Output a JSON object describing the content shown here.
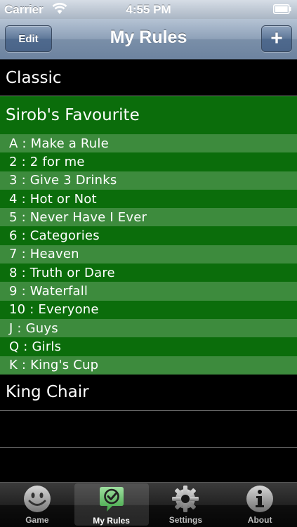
{
  "status_bar": {
    "carrier": "Carrier",
    "time": "4:55 PM"
  },
  "nav": {
    "title": "My Rules",
    "edit_label": "Edit",
    "add_label": "+"
  },
  "rule_sets": [
    {
      "name": "Classic"
    },
    {
      "name": "Sirob's Favourite",
      "selected": true,
      "rules": [
        "A : Make a Rule",
        "2 : 2 for me",
        "3 : Give 3 Drinks",
        "4 : Hot or Not",
        "5 : Never Have I Ever",
        "6 : Categories",
        "7 : Heaven",
        "8 : Truth or Dare",
        "9 : Waterfall",
        "10 : Everyone",
        "J : Guys",
        "Q : Girls",
        "K : King's Cup"
      ]
    },
    {
      "name": "King Chair"
    }
  ],
  "tabs": [
    {
      "label": "Game",
      "icon": "smiley-icon"
    },
    {
      "label": "My Rules",
      "icon": "checkmark-bubble-icon",
      "active": true
    },
    {
      "label": "Settings",
      "icon": "gear-icon"
    },
    {
      "label": "About",
      "icon": "info-icon"
    }
  ],
  "colors": {
    "selected_green": "#0b6d0b",
    "row_light_green": "#3d8b3d",
    "background": "#000000"
  }
}
